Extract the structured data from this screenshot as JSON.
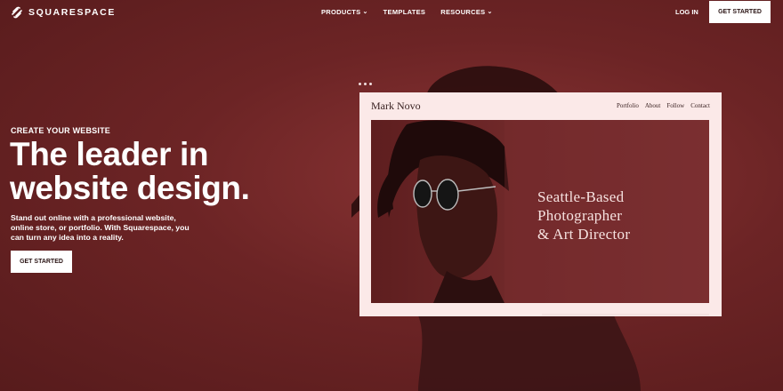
{
  "brand": {
    "name": "SQUARESPACE",
    "icon": "squarespace-logo-icon"
  },
  "nav": {
    "links": [
      {
        "label": "PRODUCTS",
        "has_dropdown": true
      },
      {
        "label": "TEMPLATES",
        "has_dropdown": false
      },
      {
        "label": "RESOURCES",
        "has_dropdown": true
      }
    ],
    "login": "LOG IN",
    "cta": "GET STARTED"
  },
  "hero": {
    "eyebrow": "CREATE YOUR WEBSITE",
    "headline": "The leader in website design.",
    "body": "Stand out online with a professional website, online store, or portfolio. With Squarespace, you can turn any idea into a reality.",
    "cta": "GET STARTED"
  },
  "mock_site": {
    "brand": "Mark Novo",
    "nav": [
      "Portfolio",
      "About",
      "Follow",
      "Contact"
    ],
    "tagline_lines": [
      "Seattle-Based",
      "Photographer",
      "& Art Director"
    ]
  },
  "colors": {
    "background": "#6c2425",
    "mock_window": "#fbe9e8",
    "button": "#ffffff",
    "button_text": "#2a1414"
  }
}
